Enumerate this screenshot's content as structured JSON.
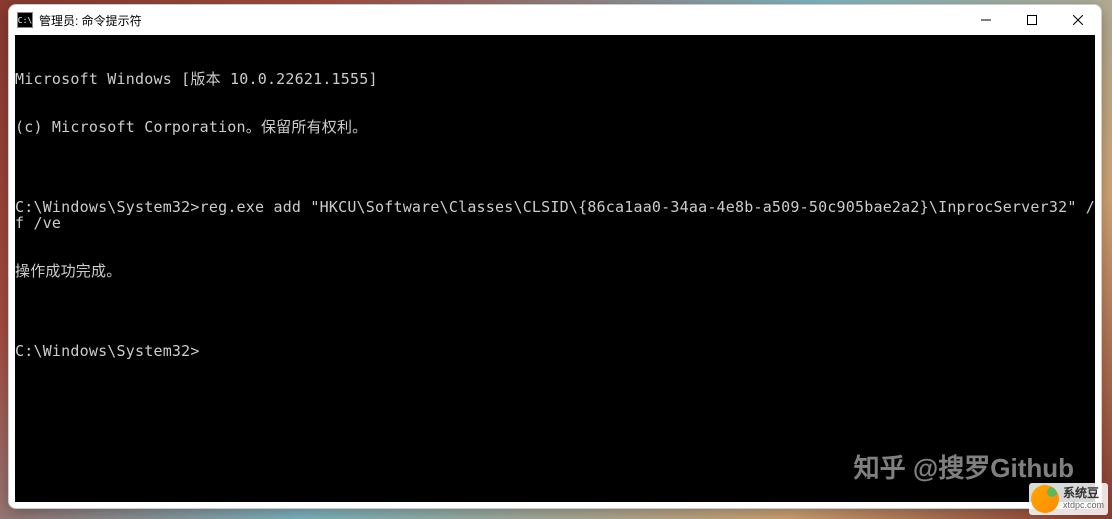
{
  "window": {
    "title": "管理员: 命令提示符",
    "icon_label": "C:\\"
  },
  "terminal": {
    "line1": "Microsoft Windows [版本 10.0.22621.1555]",
    "line2": "(c) Microsoft Corporation。保留所有权利。",
    "blank1": "",
    "line3_prompt": "C:\\Windows\\System32>",
    "line3_cmd": "reg.exe add \"HKCU\\Software\\Classes\\CLSID\\{86ca1aa0-34aa-4e8b-a509-50c905bae2a2}\\InprocServer32\" /f /ve",
    "line4": "操作成功完成。",
    "blank2": "",
    "line5_prompt": "C:\\Windows\\System32>"
  },
  "watermarks": {
    "zhihu": "知乎 @搜罗Github",
    "corner_main": "系统豆",
    "corner_sub": "xtdpc.com"
  }
}
